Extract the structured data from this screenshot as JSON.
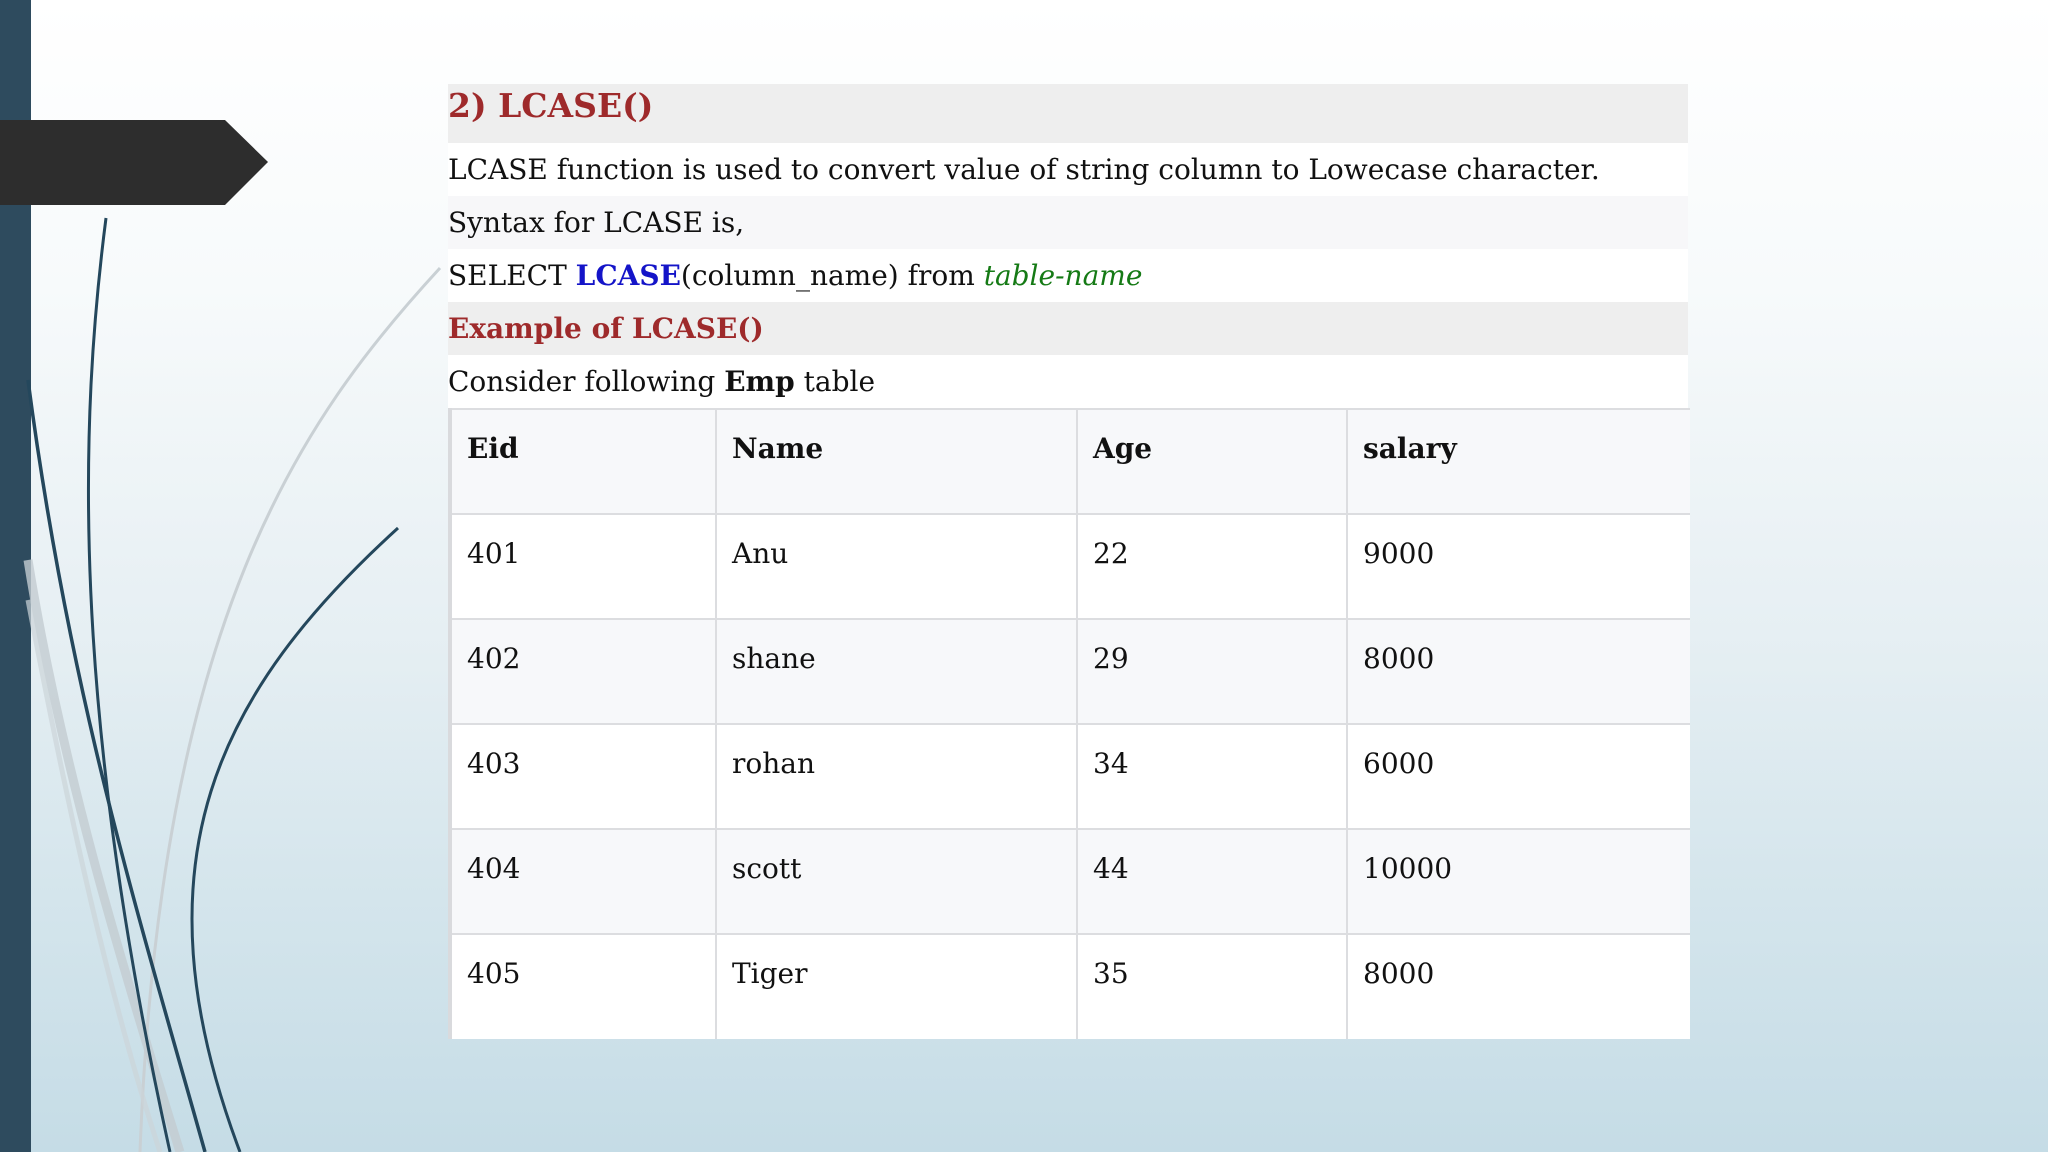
{
  "slide": {
    "title": "2) LCASE()",
    "description": "LCASE function is used to convert value of string column to Lowecase character.",
    "syntax_intro": "Syntax for LCASE is,",
    "syntax": {
      "select": "SELECT ",
      "function": "LCASE",
      "args": "(column_name) from ",
      "table": "table-name"
    },
    "example_heading": "Example of LCASE()",
    "consider": {
      "prefix": "Consider following ",
      "table_name": "Emp",
      "suffix": " table"
    }
  },
  "emp_table": {
    "headers": [
      "Eid",
      "Name",
      "Age",
      "salary"
    ],
    "rows": [
      [
        "401",
        "Anu",
        "22",
        "9000"
      ],
      [
        "402",
        "shane",
        "29",
        "8000"
      ],
      [
        "403",
        "rohan",
        "34",
        "6000"
      ],
      [
        "404",
        "scott",
        "44",
        "10000"
      ],
      [
        "405",
        "Tiger",
        "35",
        "8000"
      ]
    ]
  },
  "colors": {
    "left_bar": "#2e4b5e",
    "heading_red": "#9e2a2b",
    "keyword_blue": "#1414c8",
    "table_name_green": "#157a15",
    "arrow_tab": "#2d2d2d"
  }
}
